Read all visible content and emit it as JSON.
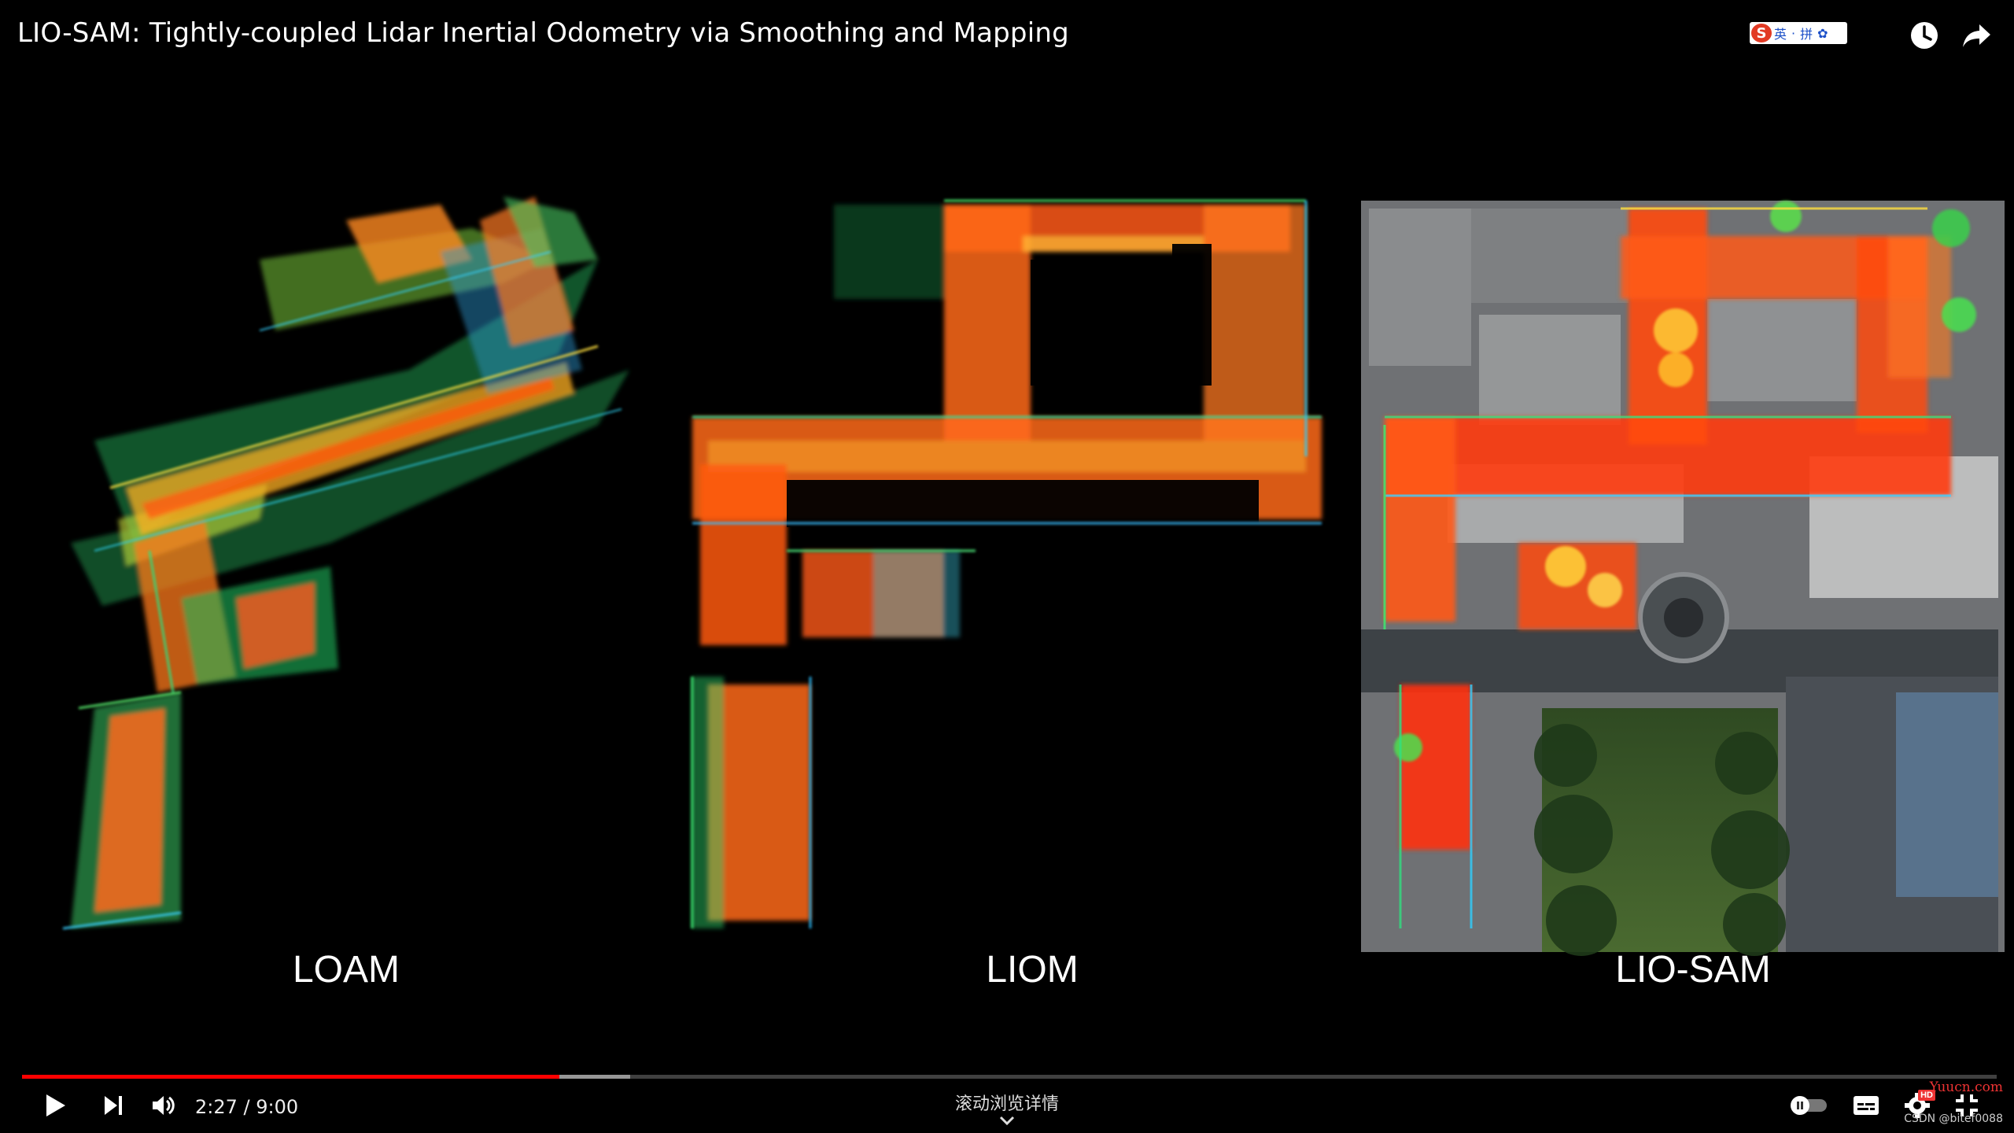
{
  "video": {
    "title": "LIO-SAM: Tightly-coupled Lidar Inertial Odometry via Smoothing and Mapping"
  },
  "ime": {
    "logo": "S",
    "items": [
      "英",
      "·",
      "拼",
      "✿"
    ]
  },
  "icons": {
    "watch_later": "clock-icon",
    "share": "share-icon",
    "play": "play-icon",
    "next": "next-icon",
    "volume": "volume-icon",
    "autoplay": "autoplay-toggle-icon",
    "subtitles": "subtitles-icon",
    "settings": "gear-icon",
    "hd_badge": "HD",
    "exit_fullscreen": "exit-fullscreen-icon"
  },
  "panels": [
    {
      "label": "LOAM"
    },
    {
      "label": "LIOM"
    },
    {
      "label": "LIO-SAM"
    }
  ],
  "player": {
    "current_time": "2:27",
    "duration": "9:00",
    "time_display": "2:27 / 9:00",
    "played_fraction": 0.272,
    "buffered_fraction": 0.308,
    "scroll_hint": "滚动浏览详情"
  },
  "watermark": {
    "site": "Yuucn.com",
    "credit": "CSDN @bitef0088"
  },
  "colors": {
    "progress_played": "#ff0000",
    "background": "#000000"
  }
}
